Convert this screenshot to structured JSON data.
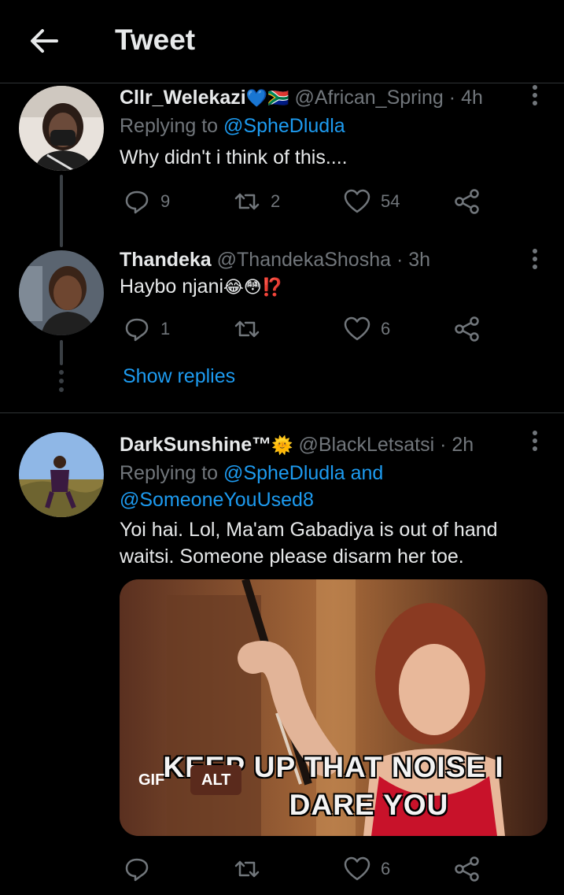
{
  "header": {
    "title": "Tweet",
    "back_icon": "arrow-left-icon"
  },
  "tweets": [
    {
      "name": "Cllr_Welekazi",
      "name_emoji": "💙🇿🇦",
      "handle": "@African_Spring",
      "time": "· 4h",
      "replying_prefix": "Replying to ",
      "replying_to": "@SpheDludla",
      "text": "Why didn't i think of this....",
      "replies": "9",
      "retweets": "2",
      "likes": "54"
    },
    {
      "name": "Thandeka",
      "handle": "@ThandekaShosha",
      "time": "· 3h",
      "text": "Haybo njani",
      "text_emoji": "😂😳⁉️",
      "replies": "1",
      "retweets": "",
      "likes": "6",
      "show_replies": "Show replies"
    },
    {
      "name": "DarkSunshine™",
      "name_emoji": "🌞",
      "handle": "@BlackLetsatsi",
      "time": "· 2h",
      "replying_prefix": "Replying to ",
      "replying_to": "@SpheDludla and",
      "replying_to_2": "@SomeoneYouUsed8",
      "text_line1": "Yoi hai. Lol, Ma'am Gabadiya is out of hand",
      "text_line2": "waitsi. Someone please disarm her toe.",
      "media": {
        "caption_line1": "KEEP UP THAT NOISE I",
        "caption_line2": "DARE YOU",
        "gif_badge": "GIF",
        "alt_badge": "ALT"
      },
      "replies": "",
      "retweets": "",
      "likes": "6"
    }
  ],
  "colors": {
    "accent": "#1d9bf0",
    "muted": "#71767b",
    "background": "#000000"
  }
}
